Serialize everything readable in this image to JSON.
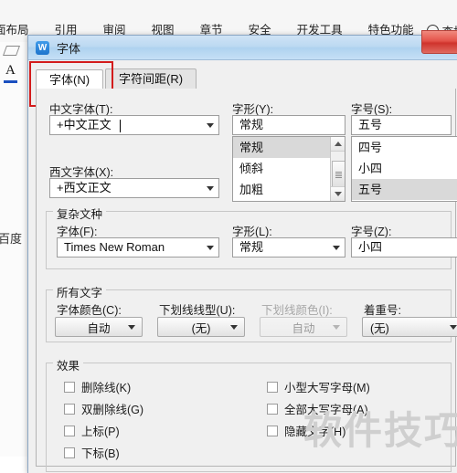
{
  "ribbon": {
    "tabs": [
      {
        "label": "面布局"
      },
      {
        "label": "引用"
      },
      {
        "label": "审阅"
      },
      {
        "label": "视图"
      },
      {
        "label": "章节"
      },
      {
        "label": "安全"
      },
      {
        "label": "开发工具"
      },
      {
        "label": "特色功能"
      }
    ],
    "find_label": "查找"
  },
  "sidebar": {
    "letter_icon": "A",
    "baidu_label": "百度"
  },
  "dialog": {
    "icon_text": "W",
    "title": "字体",
    "tabs": [
      {
        "label": "字体(N)",
        "active": true
      },
      {
        "label": "字符间距(R)",
        "active": false
      }
    ],
    "highlight_color": "#d31b1b",
    "chinese_font": {
      "label": "中文字体(T):",
      "value": "+中文正文"
    },
    "western_font": {
      "label": "西文字体(X):",
      "value": "+西文正文"
    },
    "font_style": {
      "label": "字形(Y):",
      "value": "常规",
      "options": [
        "常规",
        "倾斜",
        "加粗"
      ],
      "selected_index": 0
    },
    "font_size": {
      "label": "字号(S):",
      "value": "五号",
      "options": [
        "四号",
        "小四",
        "五号"
      ],
      "selected_index": 2
    },
    "complex_group": {
      "title": "复杂文种",
      "font": {
        "label": "字体(F):",
        "value": "Times New Roman"
      },
      "style": {
        "label": "字形(L):",
        "value": "常规"
      },
      "size": {
        "label": "字号(Z):",
        "value": "小四"
      }
    },
    "all_text_group": {
      "title": "所有文字",
      "font_color": {
        "label": "字体颜色(C):",
        "value": "自动",
        "disabled": false
      },
      "underline_style": {
        "label": "下划线线型(U):",
        "value": "(无)",
        "disabled": false
      },
      "underline_color": {
        "label": "下划线颜色(I):",
        "value": "自动",
        "disabled": true
      },
      "emphasis_mark": {
        "label": "着重号:",
        "value": "(无)",
        "disabled": false
      }
    },
    "effects_group": {
      "title": "效果",
      "left_column": [
        {
          "label": "删除线(K)",
          "checked": false
        },
        {
          "label": "双删除线(G)",
          "checked": false
        },
        {
          "label": "上标(P)",
          "checked": false
        },
        {
          "label": "下标(B)",
          "checked": false
        }
      ],
      "right_column": [
        {
          "label": "小型大写字母(M)",
          "checked": false
        },
        {
          "label": "全部大写字母(A)",
          "checked": false
        },
        {
          "label": "隐藏文字(H)",
          "checked": false
        }
      ]
    }
  },
  "watermark": {
    "text": "软件技巧"
  }
}
